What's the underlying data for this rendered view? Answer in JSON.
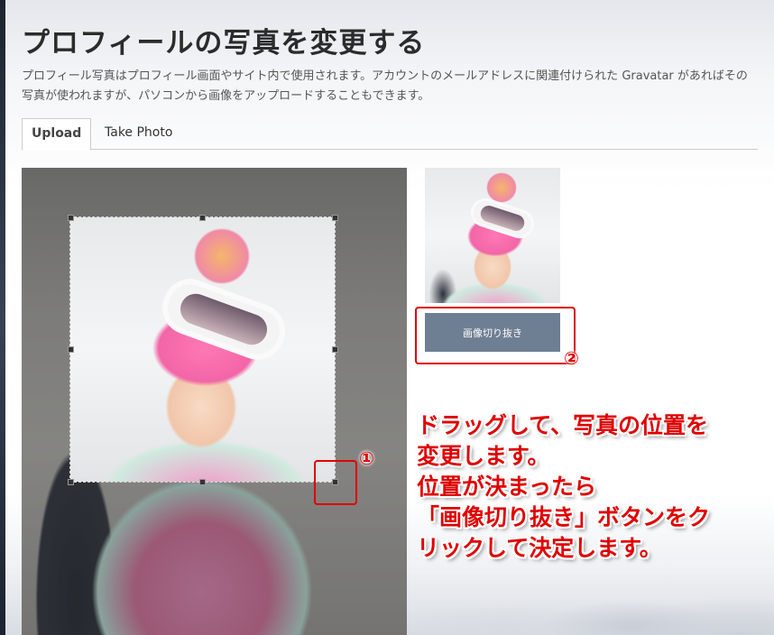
{
  "page": {
    "title": "プロフィールの写真を変更する",
    "description": "プロフィール写真はプロフィール画面やサイト内で使用されます。アカウントのメールアドレスに関連付けられた Gravatar があればその写真が使われますが、パソコンから画像をアップロードすることもできます。"
  },
  "tabs": [
    {
      "label": "Upload",
      "active": true
    },
    {
      "label": "Take Photo",
      "active": false
    }
  ],
  "crop": {
    "button_label": "画像切り抜き"
  },
  "annotations": {
    "marker1": "①",
    "marker2": "②",
    "instructions": "ドラッグして、写真の位置を\n変更します。\n位置が決まったら\n「画像切り抜き」ボタンをク\nリックして決定します。",
    "color": "#e00000"
  }
}
